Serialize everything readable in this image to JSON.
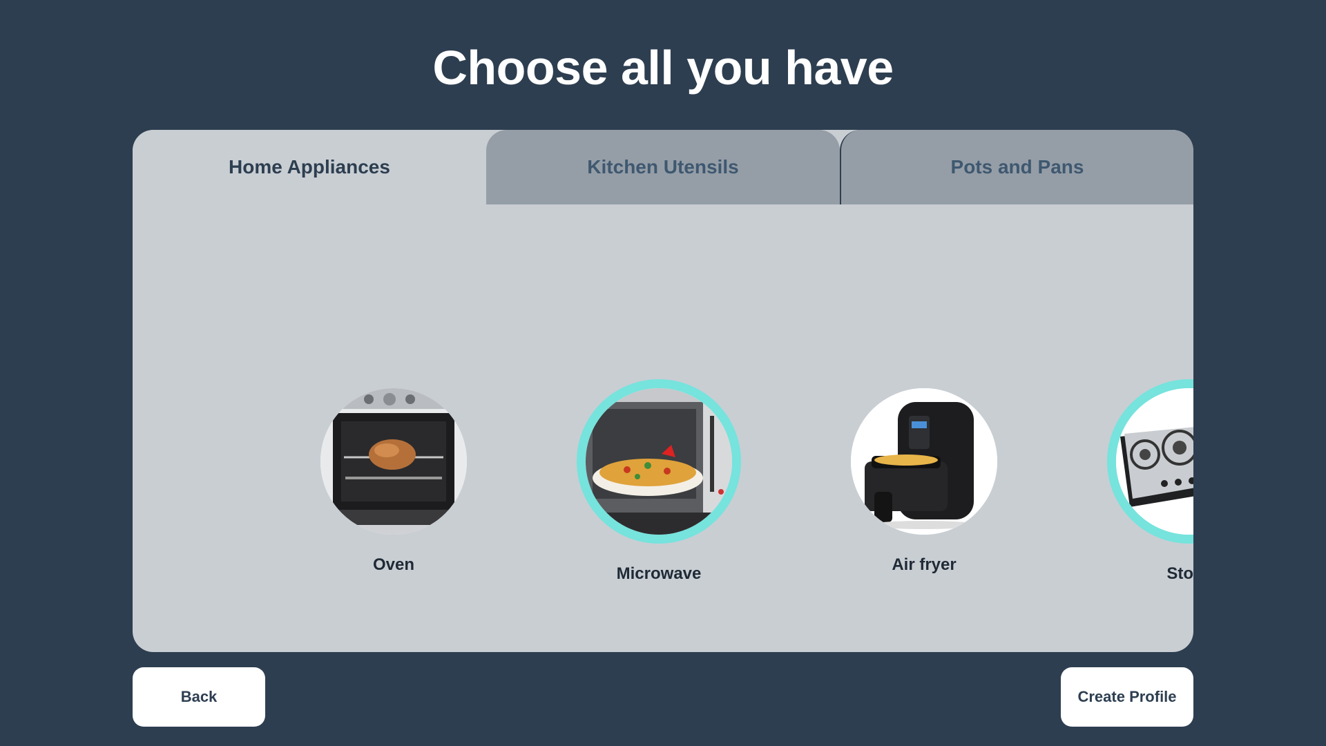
{
  "page": {
    "title": "Choose all you have"
  },
  "tabs": [
    {
      "label": "Home Appliances",
      "active": true
    },
    {
      "label": "Kitchen Utensils",
      "active": false
    },
    {
      "label": "Pots and Pans",
      "active": false
    }
  ],
  "appliances": [
    {
      "label": "Oven",
      "icon": "oven-image",
      "selected": false
    },
    {
      "label": "Microwave",
      "icon": "microwave-image",
      "selected": true
    },
    {
      "label": "Air fryer",
      "icon": "air-fryer-image",
      "selected": false
    },
    {
      "label": "Stove",
      "icon": "stove-image",
      "selected": true
    }
  ],
  "buttons": {
    "back": "Back",
    "create": "Create Profile"
  },
  "colors": {
    "background": "#2d3e50",
    "panel": "#c9ced3",
    "inactive_tab": "#959ea7",
    "selection_ring": "#76e3dd"
  }
}
